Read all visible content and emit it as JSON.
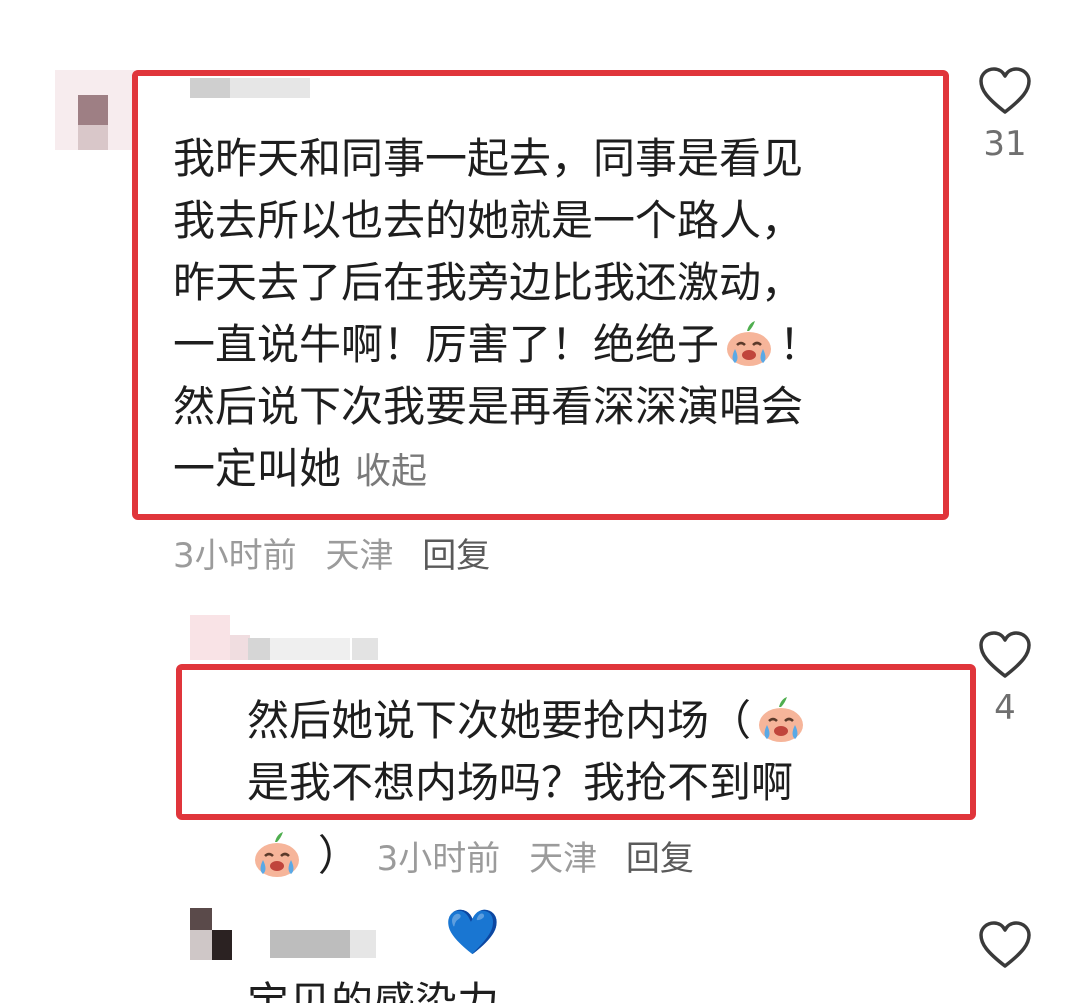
{
  "comments": [
    {
      "lines": [
        "我昨天和同事一起去，同事是看见",
        "我去所以也去的她就是一个路人，",
        "昨天去了后在我旁边比我还激动，",
        "一直说牛啊！厉害了！绝绝子",
        "然后说下次我要是再看深深演唱会",
        "一定叫她"
      ],
      "line4_tail": "！",
      "collapse_label": "收起",
      "time": "3小时前",
      "location": "天津",
      "reply_label": "回复",
      "like_count": "31"
    },
    {
      "line1": "然后她说下次她要抢内场（",
      "line2": "是我不想内场吗？我抢不到啊",
      "line3_tail": "）",
      "time": "3小时前",
      "location": "天津",
      "reply_label": "回复",
      "like_count": "4"
    },
    {
      "partial_text": "宝贝的感染力",
      "badge_emoji": "💙"
    }
  ],
  "icons": {
    "like": "heart-outline-icon",
    "emoji": "crying-peach-emoji"
  },
  "colors": {
    "highlight": "#e0353b",
    "meta_text": "#9b9b9b"
  }
}
